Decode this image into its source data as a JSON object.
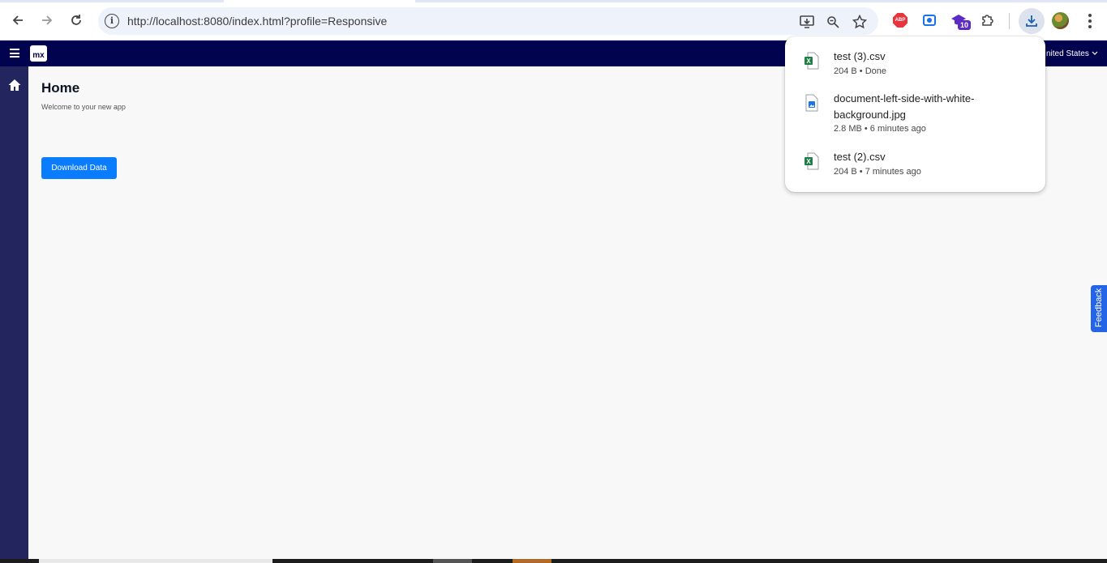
{
  "browser": {
    "url": "http://localhost:8080/index.html?profile=Responsive",
    "extension_badge": "10"
  },
  "app": {
    "logo_text": "mx",
    "language": "nited States",
    "page_title": "Home",
    "subtitle": "Welcome to your new app",
    "download_button_label": "Download Data",
    "feedback_label": "Feedback"
  },
  "downloads": {
    "items": [
      {
        "name": "test (3).csv",
        "meta": "204 B • Done",
        "icon": "excel-file-icon"
      },
      {
        "name": "document-left-side-with-white-background.jpg",
        "meta": "2.8 MB • 6 minutes ago",
        "icon": "image-file-icon"
      },
      {
        "name": "test (2).csv",
        "meta": "204 B • 7 minutes ago",
        "icon": "excel-file-icon"
      }
    ]
  },
  "colors": {
    "app_header": "#02034e",
    "sidebar": "#23255f",
    "primary": "#0a7cff",
    "feedback": "#2465e8"
  }
}
